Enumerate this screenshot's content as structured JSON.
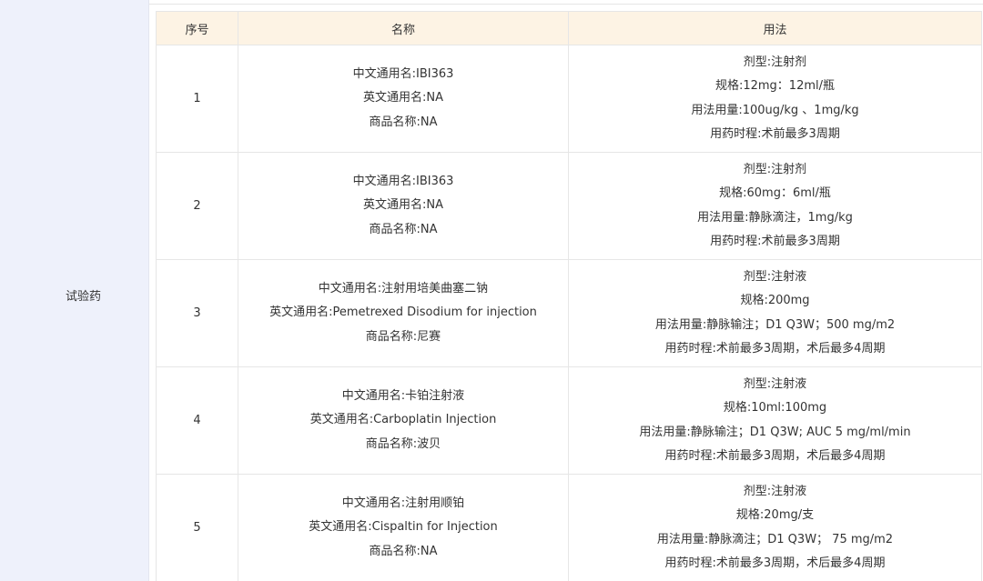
{
  "section_label": "试验药",
  "table": {
    "headers": [
      "序号",
      "名称",
      "用法"
    ],
    "rows": [
      {
        "no": "1",
        "name": [
          "中文通用名:IBI363",
          "英文通用名:NA",
          "商品名称:NA"
        ],
        "usage": [
          "剂型:注射剂",
          "规格:12mg：12ml/瓶",
          "用法用量:100ug/kg 、1mg/kg",
          "用药时程:术前最多3周期"
        ]
      },
      {
        "no": "2",
        "name": [
          "中文通用名:IBI363",
          "英文通用名:NA",
          "商品名称:NA"
        ],
        "usage": [
          "剂型:注射剂",
          "规格:60mg：6ml/瓶",
          "用法用量:静脉滴注，1mg/kg",
          "用药时程:术前最多3周期"
        ]
      },
      {
        "no": "3",
        "name": [
          "中文通用名:注射用培美曲塞二钠",
          "英文通用名:Pemetrexed Disodium for injection",
          "商品名称:尼赛"
        ],
        "usage": [
          "剂型:注射液",
          "规格:200mg",
          "用法用量:静脉输注；D1 Q3W；500 mg/m2",
          "用药时程:术前最多3周期，术后最多4周期"
        ]
      },
      {
        "no": "4",
        "name": [
          "中文通用名:卡铂注射液",
          "英文通用名:Carboplatin Injection",
          "商品名称:波贝"
        ],
        "usage": [
          "剂型:注射液",
          "规格:10ml:100mg",
          "用法用量:静脉输注；D1 Q3W; AUC 5 mg/ml/min",
          "用药时程:术前最多3周期，术后最多4周期"
        ]
      },
      {
        "no": "5",
        "name": [
          "中文通用名:注射用顺铂",
          "英文通用名:Cispaltin for Injection",
          "商品名称:NA"
        ],
        "usage": [
          "剂型:注射液",
          "规格:20mg/支",
          "用法用量:静脉滴注；D1 Q3W；  75 mg/m2",
          "用药时程:术前最多3周期，术后最多4周期"
        ]
      }
    ]
  }
}
